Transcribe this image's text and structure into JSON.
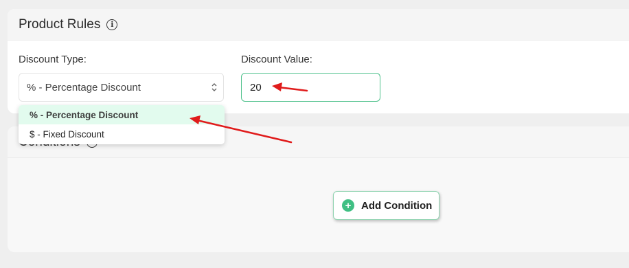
{
  "product_rules": {
    "title": "Product Rules",
    "info_icon": "info-icon",
    "discount_type": {
      "label": "Discount Type:",
      "selected": "% - Percentage Discount",
      "options": [
        "% - Percentage Discount",
        "$ - Fixed Discount"
      ]
    },
    "discount_value": {
      "label": "Discount Value:",
      "value": "20"
    }
  },
  "conditions": {
    "title": "Conditions",
    "info_icon": "info-icon",
    "add_button": {
      "label": "Add Condition",
      "icon": "plus-circle-icon"
    }
  },
  "colors": {
    "accent": "#3fbf83",
    "annotation_arrow": "#e01b1b",
    "selected_option_bg": "#e2fbee"
  }
}
